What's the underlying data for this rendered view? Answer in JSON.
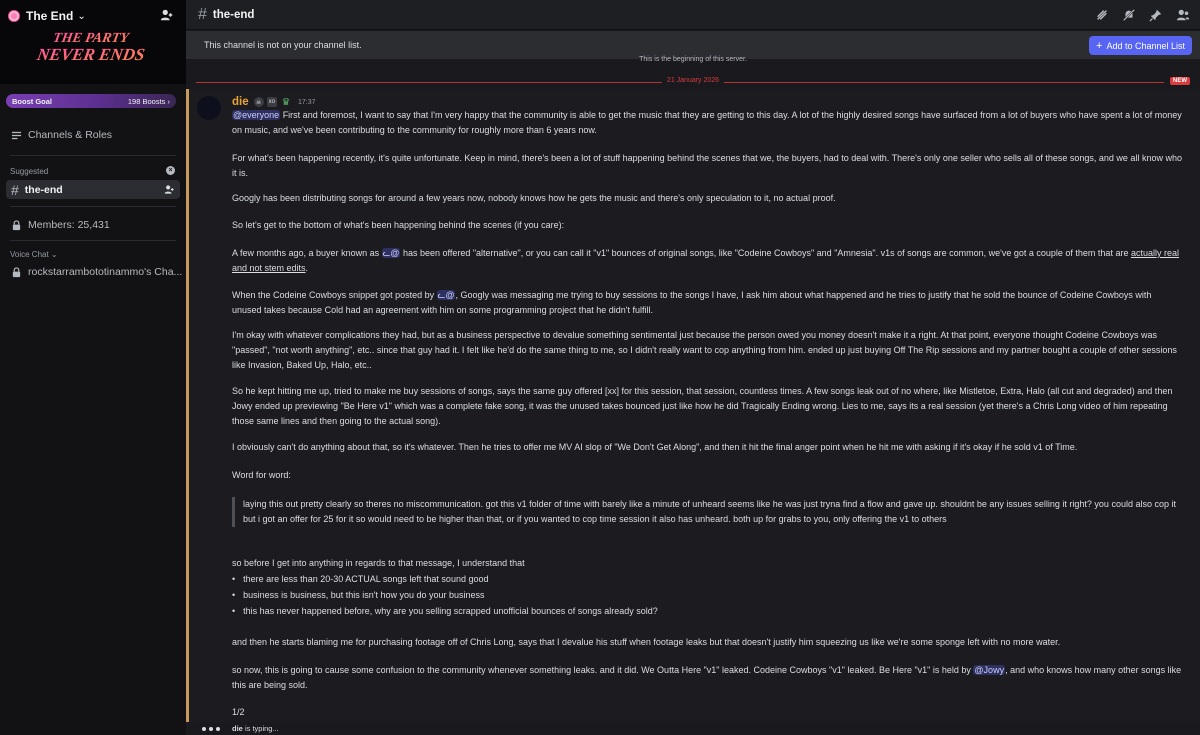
{
  "server": {
    "name": "The End",
    "banner_text": "THE PARTY NEVER ENDS",
    "boost_goal_label": "Boost Goal",
    "boost_count": "198 Boosts"
  },
  "sidebar": {
    "channels_roles": "Channels & Roles",
    "suggested_label": "Suggested",
    "active_channel": "the-end",
    "members": "Members: 25,431",
    "voice_chat_label": "Voice Chat",
    "voice_channel": "rockstarrambototinammo's Cha..."
  },
  "topbar": {
    "channel_name": "the-end"
  },
  "notice": {
    "text": "This channel is not on your channel list.",
    "button_label": "Add to Channel List"
  },
  "beginning_text": "This is the beginning of this server.",
  "date_divider": {
    "date": "21 January 2026",
    "new_label": "NEW"
  },
  "message": {
    "author": "die",
    "badge_text": "xo",
    "time": "17:37",
    "mention_everyone": "@everyone",
    "p1_rest": "First and foremost, I want to say that I'm very happy that the community is able to get the music that they are getting to this day. A lot of the highly desired songs have surfaced from a lot of buyers who have spent a lot of money on music, and we've been contributing to the community for roughly more than 6 years now.",
    "p2": "For what's been happening recently, it's quite unfortunate. Keep in mind, there's been a lot of stuff happening behind the scenes that we, the buyers, had to deal with. There's only one seller who sells all of these songs, and we all know who it is.",
    "p3": "Googly has been distributing songs for around a few years now, nobody knows how he gets the music and there's only speculation to it, no actual proof.",
    "p4": "So let's get to the bottom of what's been happening behind the scenes (if you care):",
    "p5_a": "A few months ago, a buyer known as",
    "mention_user": "ᓚ@",
    "p5_b": "has been offered \"alternative\", or you can call it \"v1\" bounces of original songs, like \"Codeine Cowboys\" and \"Amnesia\". v1s of songs are common, we've got a couple of them that are",
    "p5_link": "actually real and not stem edits",
    "p5_end": ".",
    "p6_a": "When the Codeine Cowboys snippet got posted by",
    "p6_b": ", Googly was messaging me trying to buy sessions to the songs I have, I ask him about what happened and he tries to justify that he sold the bounce of Codeine Cowboys with unused takes because Cold had an agreement with him on some programming project that he didn't fulfill.",
    "p7": "I'm okay with whatever complications they had, but as a business perspective to devalue something sentimental just because the person owed you money doesn't make it a right. At that point, everyone thought Codeine Cowboys was \"passed\", \"not worth anything\", etc.. since that guy had it. I felt like he'd do the same thing to me, so I didn't really want to cop anything from him. ended up just buying Off The Rip sessions and my partner bought a couple of other sessions like Invasion, Baked Up, Halo, etc..",
    "p8": "So he kept hitting me up, tried to make me buy sessions of songs, says the same guy offered [xx] for this session, that session, countless times. A few songs leak out of no where, like Mistletoe, Extra, Halo (all cut and degraded) and then Jowy ended up previewing \"Be Here v1\" which was a complete fake song, it was the unused takes bounced just like how he did Tragically Ending wrong. Lies to me, says its a real session (yet there's a Chris Long video of him repeating those same lines and then going to the actual song).",
    "p9": "I obviously can't do anything about that, so it's whatever. Then he tries to offer me MV AI slop of \"We Don't Get Along\", and then it hit the final anger point when he hit me with asking if it's okay if he sold v1 of Time.",
    "p10": "Word for word:",
    "quote": "laying this out pretty clearly so theres no miscommunication. got this v1 folder of time with barely like a minute of unheard seems like he was just tryna find a flow and gave up. shouldnt be any issues selling it right? you could also cop it but i got an offer for 25 for it so would need to be higher than that, or if you wanted to cop time session it also has unheard. both up for grabs to you, only offering the v1 to others",
    "p11": "so before I get into anything in regards to that message, I understand that",
    "bullets": [
      "there are less than 20-30 ACTUAL songs left that sound good",
      "business is business, but this isn't how you do your business",
      "this has never happened before, why are you selling scrapped unofficial bounces of songs already sold?"
    ],
    "p12": "and then he starts blaming me for purchasing footage off of Chris Long, says that I devalue his stuff when footage leaks but that doesn't justify him squeezing us like we're some sponge left with no more water.",
    "p13_a": "so now, this is going to cause some confusion to the community whenever something leaks. and it did. We Outta Here \"v1\" leaked. Codeine Cowboys \"v1\" leaked. Be Here \"v1\" is held by",
    "mention_jowy": "@Jowy",
    "p13_b": ", and who knows how many other songs like this are being sold.",
    "page": "1/2"
  },
  "typing": {
    "user": "die",
    "text": "is typing..."
  },
  "colors": {
    "accent": "#5865f2",
    "author": "#e8a23a",
    "new_divider": "#d83c3e",
    "highlight_bar": "#c89b5c"
  }
}
